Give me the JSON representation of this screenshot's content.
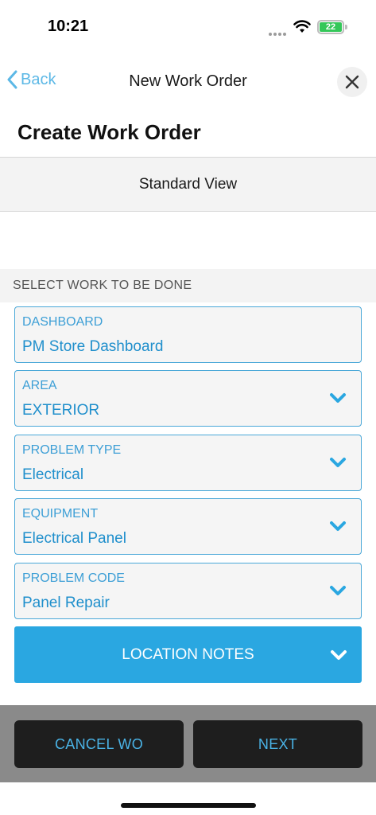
{
  "status_bar": {
    "time": "10:21",
    "battery": "22"
  },
  "nav": {
    "back_label": "Back",
    "title": "New Work Order"
  },
  "page_title": "Create Work Order",
  "view_toggle": "Standard View",
  "section_header": "SELECT WORK TO BE DONE",
  "fields": [
    {
      "label": "DASHBOARD",
      "value": "PM Store Dashboard",
      "has_dropdown": false
    },
    {
      "label": "AREA",
      "value": "EXTERIOR",
      "has_dropdown": true
    },
    {
      "label": "PROBLEM TYPE",
      "value": "Electrical",
      "has_dropdown": true
    },
    {
      "label": "EQUIPMENT",
      "value": "Electrical Panel",
      "has_dropdown": true
    },
    {
      "label": "PROBLEM CODE",
      "value": "Panel Repair",
      "has_dropdown": true
    }
  ],
  "location_notes_label": "LOCATION NOTES",
  "footer": {
    "cancel_label": "CANCEL WO",
    "next_label": "NEXT"
  },
  "colors": {
    "accent": "#2aa7e1",
    "field_text": "#1f8fcc",
    "footer_bg": "#8a8a8a",
    "button_bg": "#1e1e1e"
  }
}
